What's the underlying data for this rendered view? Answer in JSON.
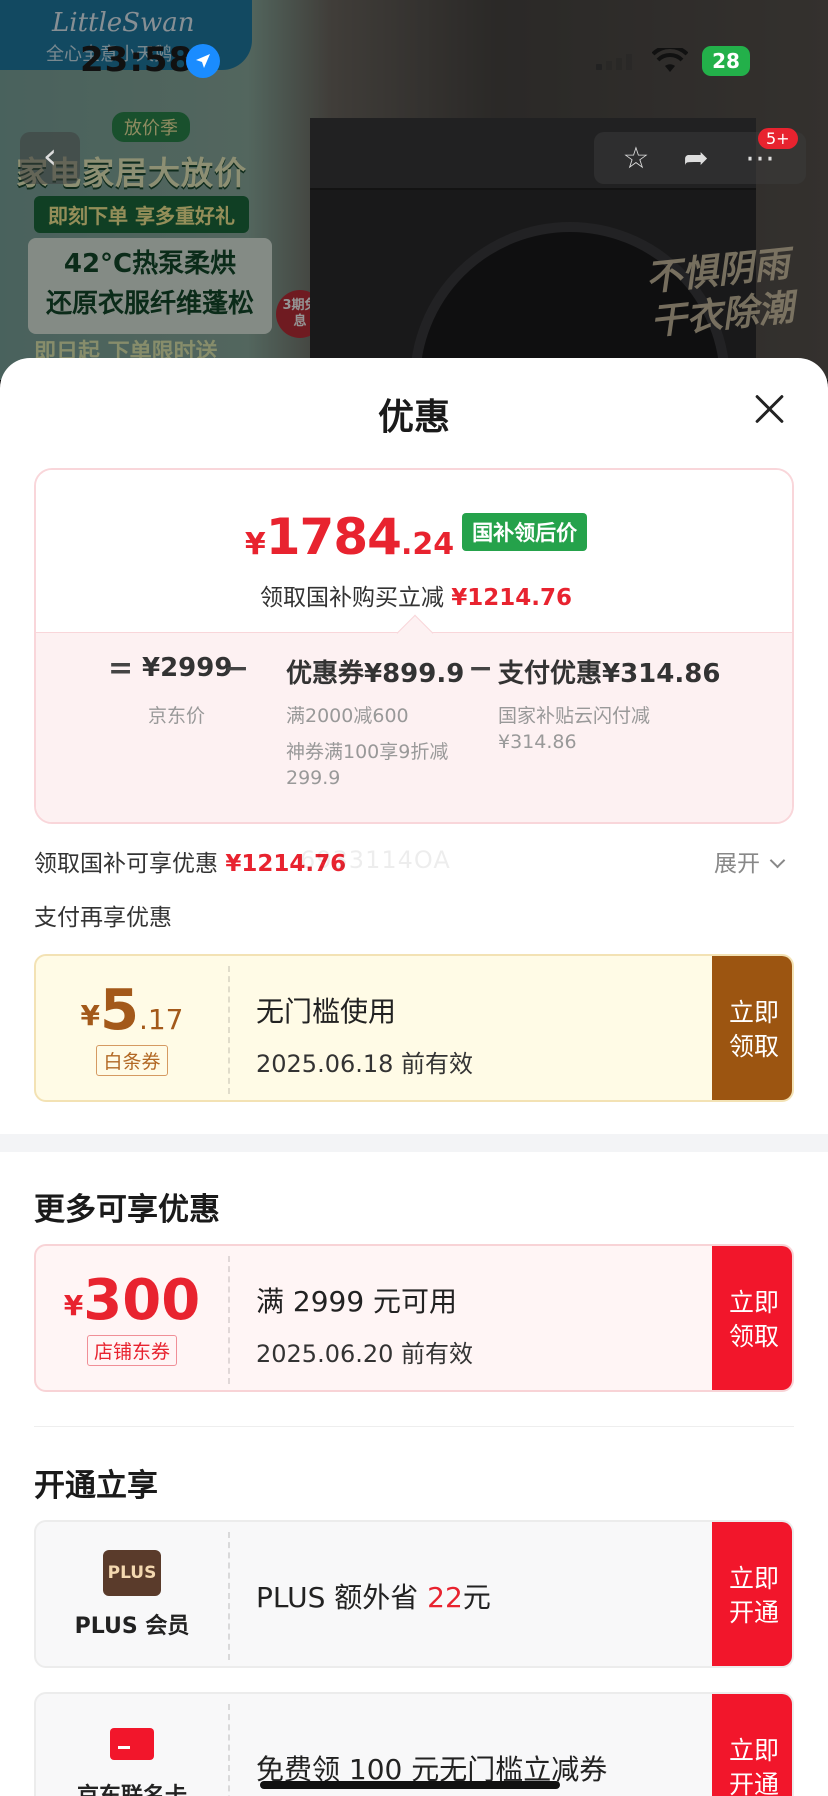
{
  "status_bar": {
    "time": "23:58",
    "battery": "28"
  },
  "background": {
    "brand": "LittleSwan",
    "brand_sub": "全心全意小天鹅",
    "promo_tag": "放价季",
    "promo_title": "家电家居大放价",
    "promo_sub": "即刻下单 享多重好礼",
    "promo_line1": "42°C热泵柔烘",
    "promo_line2": "还原衣服纤维蓬松",
    "promo_badge": "3期免息",
    "promo_foot": "即日起 下单限时送",
    "right_ad_line1": "不惧阴雨",
    "right_ad_line2": "干衣除潮",
    "nav_badge": "5+"
  },
  "sheet": {
    "title": "优惠",
    "price": {
      "yen": "¥",
      "integer": "1784",
      "decimal": ".24",
      "tag": "国补领后价",
      "save_label": "领取国补购买立减",
      "save_value": "¥1214.76"
    },
    "calc": {
      "eq": "=",
      "jd_price": "¥2999",
      "jd_label": "京东价",
      "minus1": "−",
      "coupon": "优惠券¥899.9",
      "coupon_sub1": "满2000减600",
      "coupon_sub2": "神券满100享9折减",
      "coupon_sub3": "299.9",
      "minus2": "−",
      "pay": "支付优惠¥314.86",
      "pay_sub1": "国家补贴云闪付减",
      "pay_sub2": "¥314.86"
    },
    "subsidy_row": {
      "label": "领取国补可享优惠",
      "value": "¥1214.76",
      "expand": "展开"
    },
    "pay_more_label": "支付再享优惠",
    "watermark": "6933114OA",
    "baitiao_coupon": {
      "yen": "¥",
      "amount": "5",
      "decimal": ".17",
      "type": "白条券",
      "title": "无门槛使用",
      "date": "2025.06.18 前有效",
      "button_line1": "立即",
      "button_line2": "领取"
    },
    "more_section_title": "更多可享优惠",
    "store_coupon": {
      "yen": "¥",
      "amount": "300",
      "type": "店铺东券",
      "title": "满 2999 元可用",
      "date": "2025.06.20 前有效",
      "button_line1": "立即",
      "button_line2": "领取"
    },
    "open_section_title": "开通立享",
    "plus_card": {
      "icon_text": "PLUS",
      "name": "PLUS 会员",
      "title_pre": "PLUS 额外省 ",
      "title_num": "22",
      "title_post": "元",
      "button_line1": "立即",
      "button_line2": "开通"
    },
    "jd_card": {
      "name": "京东联名卡",
      "title": "免费领 100 元无门槛立减券",
      "button_line1": "立即",
      "button_line2": "开通"
    }
  },
  "colors": {
    "accent_red": "#e8232f",
    "green_tag": "#25a24b",
    "baitiao_brown": "#9c5511"
  }
}
